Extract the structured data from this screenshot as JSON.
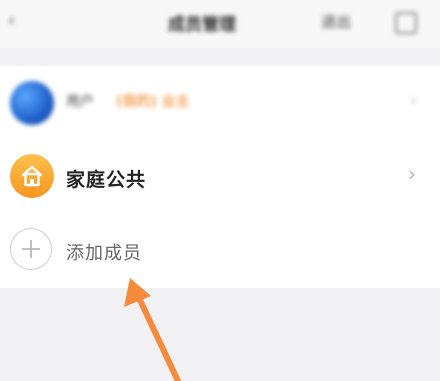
{
  "header": {
    "back_icon": "‹",
    "title": "成员管理",
    "action_label": "退出",
    "more_icon": "more-icon"
  },
  "members": [
    {
      "name": "用户",
      "tag": "(我的) 业主",
      "avatar": "avatar-blue"
    }
  ],
  "family": {
    "label": "家庭公共",
    "chevron": "›",
    "icon": "home-icon"
  },
  "add_member": {
    "label": "添加成员",
    "icon": "plus-circle-icon"
  },
  "colors": {
    "accent_orange": "#F5961F",
    "tag_orange": "#F3A35C",
    "annotation_arrow": "#F58A3C",
    "background": "#F1F1F3"
  }
}
